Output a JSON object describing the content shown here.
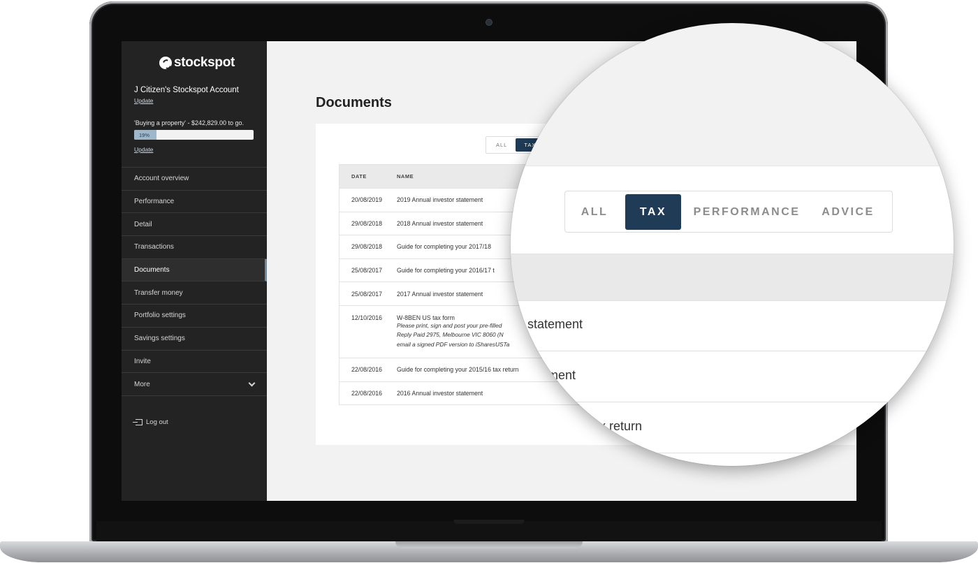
{
  "brand": {
    "logo_text": "stockspot"
  },
  "account": {
    "name": "J Citizen's Stockspot Account",
    "update_link": "Update",
    "goal_text": "'Buying a property' - $242,829.00 to go.",
    "progress_label": "19%",
    "progress_fraction": 0.19,
    "goal_update_link": "Update"
  },
  "nav": {
    "items": [
      {
        "label": "Account overview"
      },
      {
        "label": "Performance"
      },
      {
        "label": "Detail"
      },
      {
        "label": "Transactions"
      },
      {
        "label": "Documents"
      },
      {
        "label": "Transfer money"
      },
      {
        "label": "Portfolio settings"
      },
      {
        "label": "Savings settings"
      },
      {
        "label": "Invite"
      },
      {
        "label": "More"
      }
    ],
    "active": "Documents",
    "logout": "Log out"
  },
  "page": {
    "title": "Documents"
  },
  "filters": {
    "small": [
      "ALL",
      "TAX"
    ],
    "zoomed": [
      "ALL",
      "TAX",
      "PERFORMANCE",
      "ADVICE"
    ],
    "active": "TAX"
  },
  "table": {
    "headers": {
      "date": "DATE",
      "name": "NAME"
    },
    "rows": [
      {
        "date": "20/08/2019",
        "name": "2019 Annual investor statement"
      },
      {
        "date": "29/08/2018",
        "name": "2018 Annual investor statement"
      },
      {
        "date": "29/08/2018",
        "name": "Guide for completing your 2017/18"
      },
      {
        "date": "25/08/2017",
        "name": "Guide for completing your 2016/17 t"
      },
      {
        "date": "25/08/2017",
        "name": "2017 Annual investor statement"
      },
      {
        "date": "12/10/2016",
        "name": "W-8BEN US tax form",
        "notes": [
          "Please print, sign and post your pre-filled",
          "Reply Paid 2975, Melbourne VIC 8060 (N",
          "email a signed PDF version to iSharesUSTa"
        ]
      },
      {
        "date": "22/08/2016",
        "name": "Guide for completing your 2015/16 tax return"
      },
      {
        "date": "22/08/2016",
        "name": "2016 Annual investor statement"
      }
    ]
  },
  "zoom_rows": [
    "r statement",
    "tement",
    "3 tax return"
  ],
  "colors": {
    "sidebar": "#232323",
    "accent": "#1f3b55",
    "progress": "#9fb7c9"
  }
}
